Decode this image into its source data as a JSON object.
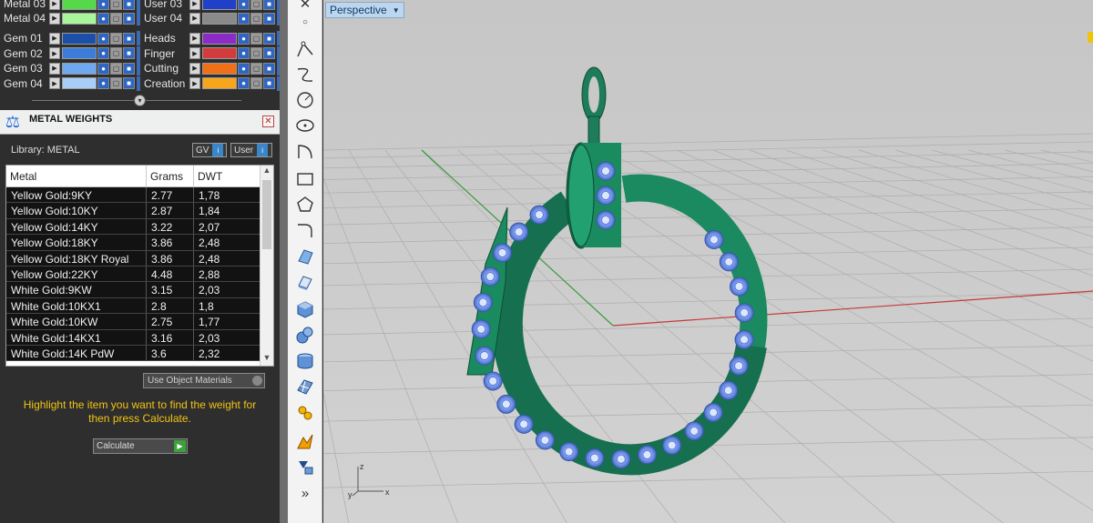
{
  "layers_top": [
    {
      "name": "Metal 03",
      "color": "#55d84a"
    },
    {
      "name": "Metal 04",
      "color": "#a8f59a"
    }
  ],
  "layers_top_right": [
    {
      "name": "User 03",
      "color": "#2040c8"
    },
    {
      "name": "User 04",
      "color": "#8a8a8a"
    }
  ],
  "layers_gem": [
    {
      "name": "Gem 01",
      "color": "#1c4fa8"
    },
    {
      "name": "Gem 02",
      "color": "#3c7dd9"
    },
    {
      "name": "Gem 03",
      "color": "#6ea8f0"
    },
    {
      "name": "Gem 04",
      "color": "#a8cdf7"
    }
  ],
  "layers_misc": [
    {
      "name": "Heads",
      "color": "#8c2cc8"
    },
    {
      "name": "Finger",
      "color": "#d23c3c"
    },
    {
      "name": "Cutting",
      "color": "#f07018"
    },
    {
      "name": "Creation",
      "color": "#f5a61a"
    }
  ],
  "panel": {
    "title": "METAL WEIGHTS",
    "close": "✕",
    "library_label": "Library: METAL",
    "gv_label": "GV",
    "user_label": "User",
    "use_object_materials": "Use Object Materials",
    "hint": "Highlight the item you want to find the weight for then press Calculate.",
    "calculate": "Calculate"
  },
  "table": {
    "headers": [
      "Metal",
      "Grams",
      "DWT"
    ],
    "rows": [
      [
        "Yellow Gold:9KY",
        "2.77",
        "1,78"
      ],
      [
        "Yellow Gold:10KY",
        "2.87",
        "1,84"
      ],
      [
        "Yellow Gold:14KY",
        "3.22",
        "2,07"
      ],
      [
        "Yellow Gold:18KY",
        "3.86",
        "2,48"
      ],
      [
        "Yellow Gold:18KY Royal",
        "3.86",
        "2,48"
      ],
      [
        "Yellow Gold:22KY",
        "4.48",
        "2,88"
      ],
      [
        "White Gold:9KW",
        "3.15",
        "2,03"
      ],
      [
        "White Gold:10KX1",
        "2.8",
        "1,8"
      ],
      [
        "White Gold:10KW",
        "2.75",
        "1,77"
      ],
      [
        "White Gold:14KX1",
        "3.16",
        "2,03"
      ],
      [
        "White Gold:14K PdW",
        "3.6",
        "2,32"
      ]
    ]
  },
  "viewport": {
    "label": "Perspective",
    "axis_x": "x",
    "axis_y": "y",
    "axis_z": "z"
  },
  "toolbar": {
    "more": "»"
  }
}
